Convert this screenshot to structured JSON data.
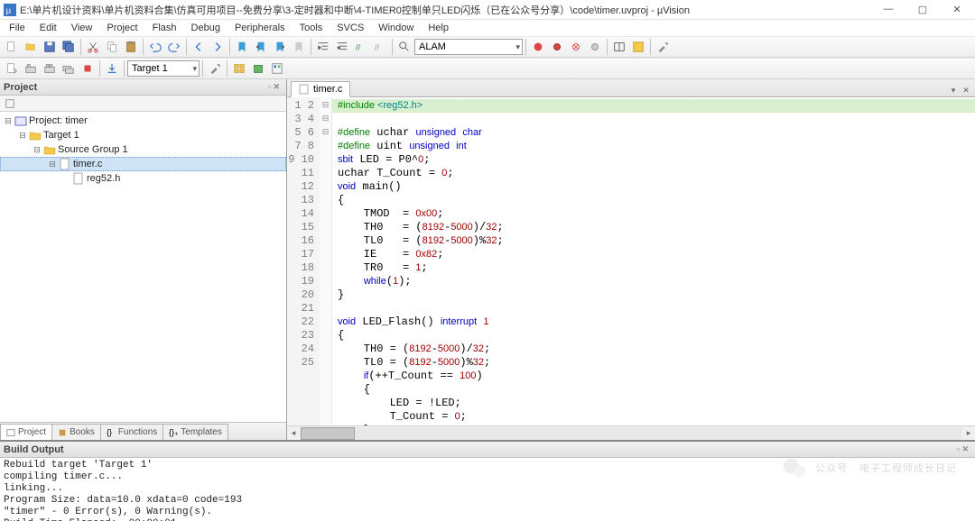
{
  "title": "E:\\单片机设计资料\\单片机资料合集\\仿真可用项目--免费分享\\3-定时器和中断\\4-TIMER0控制单只LED闪烁（已在公众号分享）\\code\\timer.uvproj - µVision",
  "menu": [
    "File",
    "Edit",
    "View",
    "Project",
    "Flash",
    "Debug",
    "Peripherals",
    "Tools",
    "SVCS",
    "Window",
    "Help"
  ],
  "toolbar2_combo": "Target 1",
  "toolbar1_combo": "ALAM",
  "project": {
    "header": "Project",
    "root": "Project: timer",
    "target": "Target 1",
    "group": "Source Group 1",
    "files": [
      "timer.c",
      "reg52.h"
    ],
    "tabs": [
      "Project",
      "Books",
      "Functions",
      "Templates"
    ]
  },
  "editor_tab": "timer.c",
  "code_lines": [
    {
      "n": 1,
      "fold": "",
      "html": "<span class='pp'>#include</span> <span class='str'>&lt;reg52.h&gt;</span>"
    },
    {
      "n": 2,
      "fold": "",
      "html": "<span class='pp'>#define</span> uchar <span class='kw'>unsigned</span> <span class='kw'>char</span>"
    },
    {
      "n": 3,
      "fold": "",
      "html": "<span class='pp'>#define</span> uint <span class='kw'>unsigned</span> <span class='kw'>int</span>"
    },
    {
      "n": 4,
      "fold": "",
      "html": "<span class='kw'>sbit</span> LED = P0^<span class='num'>0</span>;"
    },
    {
      "n": 5,
      "fold": "",
      "html": "uchar T_Count = <span class='num'>0</span>;"
    },
    {
      "n": 6,
      "fold": "",
      "html": "<span class='kw'>void</span> main()"
    },
    {
      "n": 7,
      "fold": "⊟",
      "html": "{"
    },
    {
      "n": 8,
      "fold": "",
      "html": "    TMOD  = <span class='num'>0x00</span>;"
    },
    {
      "n": 9,
      "fold": "",
      "html": "    TH0   = (<span class='num'>8192</span>-<span class='num'>5000</span>)/<span class='num'>32</span>;"
    },
    {
      "n": 10,
      "fold": "",
      "html": "    TL0   = (<span class='num'>8192</span>-<span class='num'>5000</span>)%<span class='num'>32</span>;"
    },
    {
      "n": 11,
      "fold": "",
      "html": "    IE    = <span class='num'>0x82</span>;"
    },
    {
      "n": 12,
      "fold": "",
      "html": "    TR0   = <span class='num'>1</span>;"
    },
    {
      "n": 13,
      "fold": "",
      "html": "    <span class='kw'>while</span>(<span class='num'>1</span>);"
    },
    {
      "n": 14,
      "fold": "",
      "html": "}"
    },
    {
      "n": 15,
      "fold": "",
      "html": ""
    },
    {
      "n": 16,
      "fold": "",
      "html": "<span class='kw'>void</span> LED_Flash() <span class='kw'>interrupt</span> <span class='num'>1</span>"
    },
    {
      "n": 17,
      "fold": "⊟",
      "html": "{"
    },
    {
      "n": 18,
      "fold": "",
      "html": "    TH0 = (<span class='num'>8192</span>-<span class='num'>5000</span>)/<span class='num'>32</span>;"
    },
    {
      "n": 19,
      "fold": "",
      "html": "    TL0 = (<span class='num'>8192</span>-<span class='num'>5000</span>)%<span class='num'>32</span>;"
    },
    {
      "n": 20,
      "fold": "",
      "html": "    <span class='kw'>if</span>(++T_Count == <span class='num'>100</span>)"
    },
    {
      "n": 21,
      "fold": "⊟",
      "html": "    {"
    },
    {
      "n": 22,
      "fold": "",
      "html": "        LED = !LED;"
    },
    {
      "n": 23,
      "fold": "",
      "html": "        T_Count = <span class='num'>0</span>;"
    },
    {
      "n": 24,
      "fold": "",
      "html": "    }"
    },
    {
      "n": 25,
      "fold": "",
      "html": "}"
    }
  ],
  "build": {
    "header": "Build Output",
    "lines": [
      "Rebuild target 'Target 1'",
      "compiling timer.c...",
      "linking...",
      "Program Size: data=10.0 xdata=0 code=193",
      "\"timer\" - 0 Error(s), 0 Warning(s).",
      "Build Time Elapsed:  00:00:01"
    ]
  },
  "watermark": "公众号 · 电子工程师成长日记"
}
